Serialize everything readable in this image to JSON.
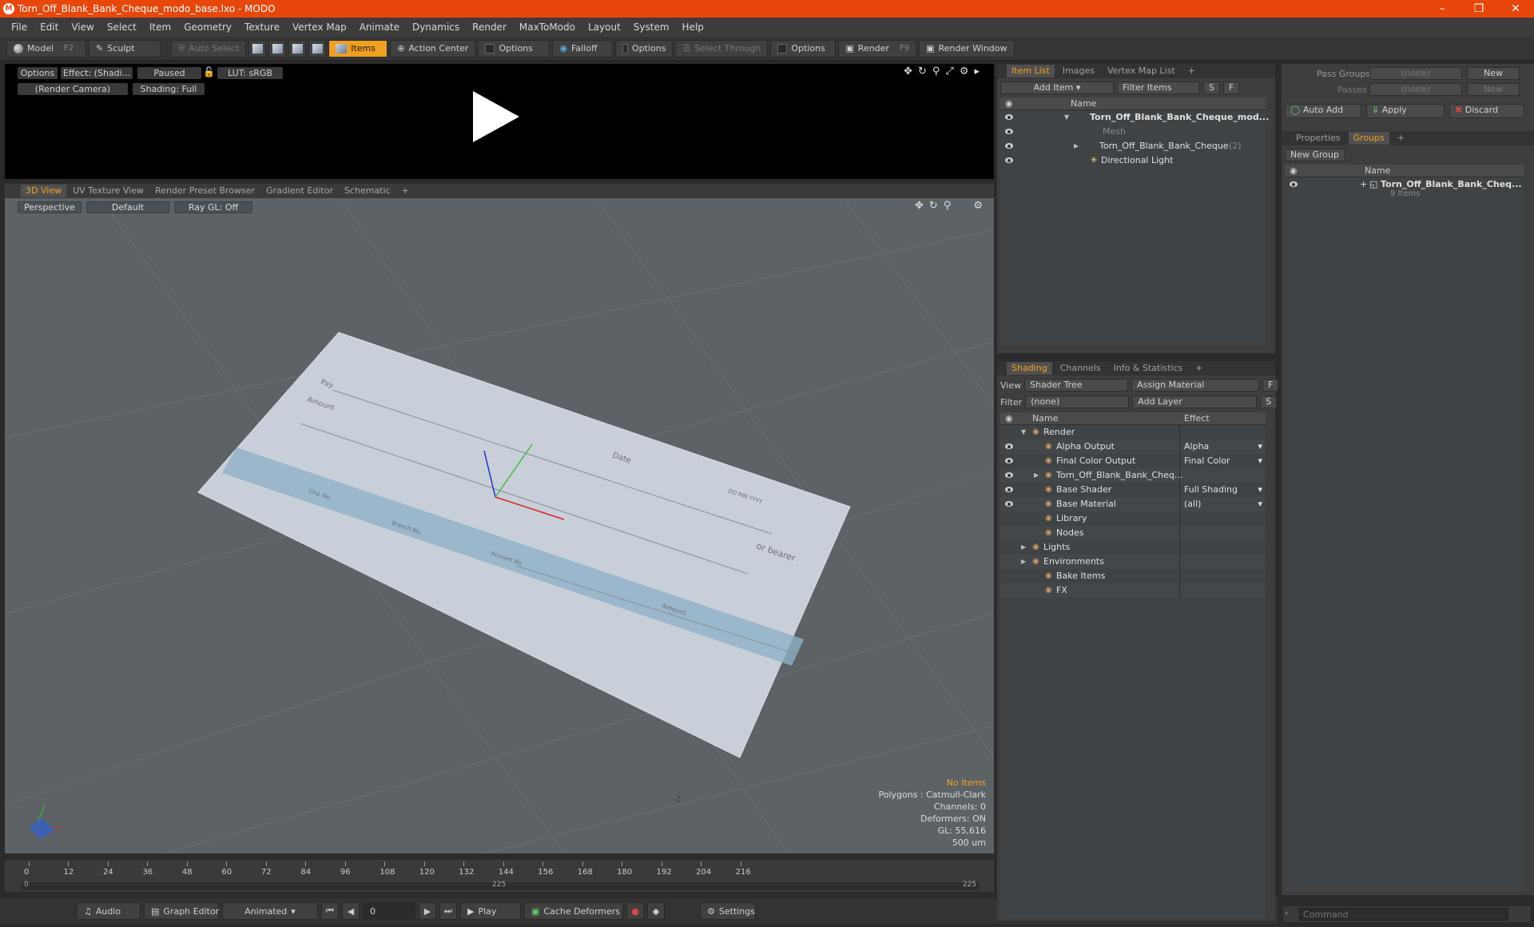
{
  "window": {
    "title": "Torn_Off_Blank_Bank_Cheque_modo_base.lxo - MODO"
  },
  "menu": [
    "File",
    "Edit",
    "View",
    "Select",
    "Item",
    "Geometry",
    "Texture",
    "Vertex Map",
    "Animate",
    "Dynamics",
    "Render",
    "MaxToModo",
    "Layout",
    "System",
    "Help"
  ],
  "toolbar": {
    "model": "Model",
    "model_key": "F2",
    "sculpt": "Sculpt",
    "auto_select": "Auto Select",
    "items": "Items",
    "action_center": "Action Center",
    "options1": "Options",
    "falloff": "Falloff",
    "options2": "Options",
    "select_through": "Select Through",
    "options3": "Options",
    "render": "Render",
    "render_key": "F9",
    "render_window": "Render Window"
  },
  "preview": {
    "options": "Options",
    "effect": "Effect: (Shadi...",
    "paused": "Paused",
    "lut": "LUT: sRGB",
    "camera": "(Render Camera)",
    "shading": "Shading: Full"
  },
  "view_tabs": [
    "3D View",
    "UV Texture View",
    "Render Preset Browser",
    "Gradient Editor",
    "Schematic",
    "+"
  ],
  "viewport": {
    "perspective": "Perspective",
    "default": "Default",
    "raygl": "Ray GL: Off",
    "cheque_text": {
      "pay": "Pay",
      "amount": "Amount",
      "date": "Date",
      "dd": "DD MM YYYY",
      "bearer": "or bearer",
      "chq": "Chq. No.",
      "branch": "Branch No.",
      "account": "Account No.",
      "amount2": "Amount"
    },
    "z_label": "-Z",
    "stats": {
      "no_items": "No Items",
      "polygons": "Polygons : Catmull-Clark",
      "channels": "Channels: 0",
      "deformers": "Deformers: ON",
      "gl": "GL: 55,616",
      "scale": "500 um"
    }
  },
  "timeline": {
    "ticks": [
      "0",
      "12",
      "24",
      "36",
      "48",
      "60",
      "72",
      "84",
      "96",
      "108",
      "120",
      "132",
      "144",
      "156",
      "168",
      "180",
      "192",
      "204",
      "216"
    ],
    "lower": [
      "0",
      "225",
      "225"
    ]
  },
  "bottombar": {
    "audio": "Audio",
    "graph": "Graph Editor",
    "animated": "Animated",
    "frame": "0",
    "play": "Play",
    "cache": "Cache Deformers",
    "settings": "Settings"
  },
  "itemlist": {
    "tabs": [
      "Item List",
      "Images",
      "Vertex Map List",
      "+"
    ],
    "add_item": "Add Item",
    "filter": "Filter Items",
    "s": "S",
    "f": "F",
    "col_name": "Name",
    "rows": [
      {
        "name": "Torn_Off_Blank_Bank_Cheque_mod..."
      },
      {
        "name": "Mesh"
      },
      {
        "name": "Torn_Off_Blank_Bank_Cheque",
        "count": "(2)"
      },
      {
        "name": "Directional Light"
      }
    ]
  },
  "shading": {
    "tabs": [
      "Shading",
      "Channels",
      "Info & Statistics",
      "+"
    ],
    "view_label": "View",
    "view_value": "Shader Tree",
    "assign": "Assign Material",
    "f": "F",
    "filter_label": "Filter",
    "filter_value": "(none)",
    "add_layer": "Add Layer",
    "s": "S",
    "col_name": "Name",
    "col_effect": "Effect",
    "rows": [
      {
        "name": "Render",
        "effect": ""
      },
      {
        "name": "Alpha Output",
        "effect": "Alpha"
      },
      {
        "name": "Final Color Output",
        "effect": "Final Color"
      },
      {
        "name": "Torn_Off_Blank_Bank_Cheq...",
        "effect": ""
      },
      {
        "name": "Base Shader",
        "effect": "Full Shading"
      },
      {
        "name": "Base Material",
        "effect": "(all)"
      },
      {
        "name": "Library",
        "effect": ""
      },
      {
        "name": "Nodes",
        "effect": ""
      },
      {
        "name": "Lights",
        "effect": ""
      },
      {
        "name": "Environments",
        "effect": ""
      },
      {
        "name": "Bake Items",
        "effect": ""
      },
      {
        "name": "FX",
        "effect": ""
      }
    ]
  },
  "groups": {
    "pass_groups": "Pass Groups",
    "pass_groups_val": "(none)",
    "new1": "New",
    "passes": "Passes",
    "passes_val": "(none)",
    "new2": "New",
    "auto_add": "Auto Add",
    "apply": "Apply",
    "discard": "Discard",
    "tabs": [
      "Properties",
      "Groups",
      "+"
    ],
    "new_group": "New Group",
    "col_name": "Name",
    "group_name": "Torn_Off_Blank_Bank_Cheq...",
    "group_count": "9 Items"
  },
  "command": {
    "placeholder": "Command"
  }
}
